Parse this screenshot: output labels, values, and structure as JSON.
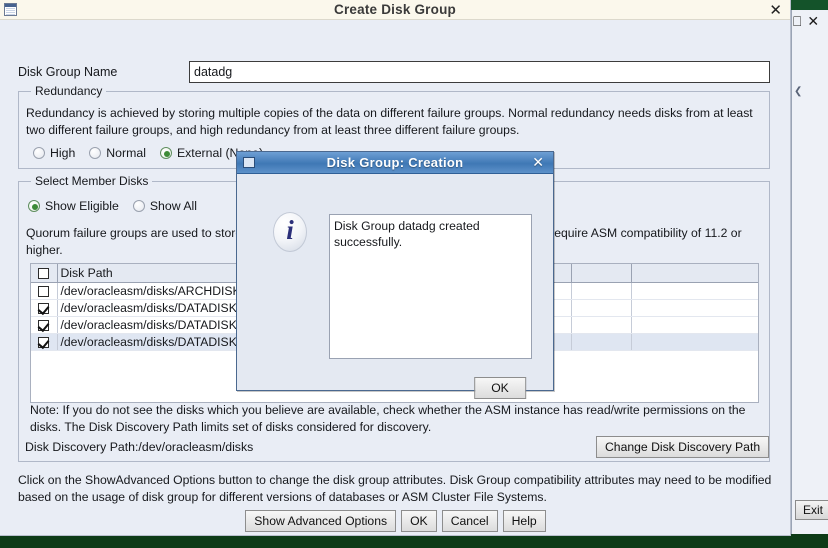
{
  "background_window": {
    "maximize_icon": "maximize-icon",
    "close_icon": "close-icon",
    "caret_icon": "chevron-left-icon",
    "exit_label": "Exit"
  },
  "main_window": {
    "title": "Create Disk Group",
    "close_icon": "close-icon",
    "window_icon": "window-icon",
    "disk_group_name": {
      "label": "Disk Group Name",
      "value": "datadg",
      "placeholder": ""
    },
    "redundancy": {
      "legend": "Redundancy",
      "description": "Redundancy is achieved by storing multiple copies of the data on different failure groups. Normal redundancy needs disks from at least two different failure groups, and high redundancy from at least three different failure groups.",
      "options": [
        {
          "label": "High",
          "selected": false
        },
        {
          "label": "Normal",
          "selected": false
        },
        {
          "label": "External (None)",
          "selected": true
        }
      ]
    },
    "select_member_disks": {
      "legend": "Select Member Disks",
      "filter_options": [
        {
          "label": "Show Eligible",
          "selected": true
        },
        {
          "label": "Show All",
          "selected": false
        }
      ],
      "quorum_note": "Quorum failure groups are used to store voting files and they cannot contain any user data. They require ASM compatibility of 11.2 or higher.",
      "table": {
        "headers": [
          "",
          "Disk Path",
          "",
          "",
          ""
        ],
        "header_checkbox_checked": false,
        "rows": [
          {
            "checked": false,
            "path": "/dev/oracleasm/disks/ARCHDISK1",
            "selected": false
          },
          {
            "checked": true,
            "path": "/dev/oracleasm/disks/DATADISK1",
            "selected": false
          },
          {
            "checked": true,
            "path": "/dev/oracleasm/disks/DATADISK2",
            "selected": false
          },
          {
            "checked": true,
            "path": "/dev/oracleasm/disks/DATADISK3",
            "selected": true
          }
        ]
      },
      "note_line1": "Note: If you do not see the disks which you believe are available, check whether the ASM instance has read/write permissions on the disks.",
      "note_line2": "The Disk Discovery Path limits set of disks considered for discovery.",
      "discovery_path_label": "Disk Discovery Path:/dev/oracleasm/disks",
      "change_discovery_path_label": "Change Disk Discovery Path"
    },
    "footer_text": "Click on the ShowAdvanced Options button to change the disk group attributes. Disk Group compatibility attributes may need to be modified based on the usage of disk group for different versions of databases or ASM Cluster File Systems.",
    "buttons": [
      {
        "label": "Show Advanced Options"
      },
      {
        "label": "OK"
      },
      {
        "label": "Cancel"
      },
      {
        "label": "Help"
      }
    ]
  },
  "modal": {
    "title": "Disk Group: Creation",
    "window_icon": "window-icon",
    "close_icon": "close-icon",
    "info_icon": "info-icon",
    "message": "Disk Group datadg created successfully.",
    "ok_label": "OK"
  },
  "colors": {
    "desktop": "#0d3b17",
    "dialog_face": "#e9edf5",
    "main_titlebar": "#fbf8ec",
    "modal_titlebar_accent": "#3f78b5",
    "radio_selected": "#3d8b37",
    "selection": "#dfe6f2"
  }
}
